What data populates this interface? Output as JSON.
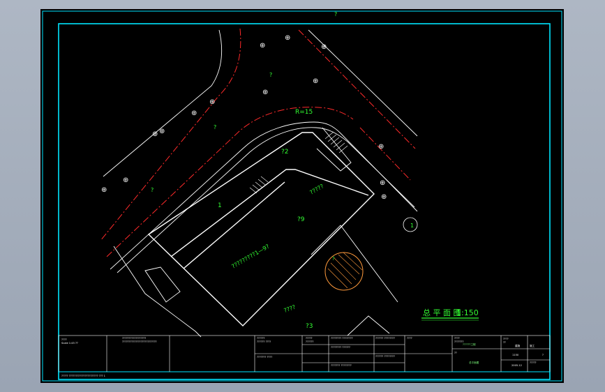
{
  "drawing": {
    "top_marker": "?",
    "radius_label": "R=15",
    "road_label_top": "?",
    "road_label_mid": "?",
    "road_label_left": "?",
    "area_label_1": "1",
    "area_label_2": "?2",
    "area_label_3": "?3",
    "area_label_29": "?9",
    "building_label": "?????????1—9?",
    "stair_label": "?????",
    "lower_label": "????",
    "right_circle_label": "1",
    "hatch_label": "?",
    "tree_symbol": "⊕",
    "plan_title": "总 平 面 图",
    "plan_scale": "1:150",
    "colors": {
      "frame": "#00e5ff",
      "building": "#ffffff",
      "road": "#ff2a2a",
      "text": "#33ff33",
      "hatch": "#ff9a3c",
      "title": "#33ff33"
    }
  },
  "title_block": {
    "cell_a1": "????",
    "cell_a2": "Scale 1:45 ??",
    "cell_b1": "??????????????????",
    "cell_b2": "??????????????????????????",
    "cell_c1": "??????",
    "cell_c2": "?????? ????",
    "cell_c3": "??????? ????",
    "cell_d1": "?????",
    "cell_d2": "??????",
    "cell_e1": "???????? ????????",
    "cell_e2": "???????? ??????",
    "cell_e3": "??????? ????????",
    "cell_f1": "?????? ????????",
    "cell_f2": "?????? ????????",
    "cell_g1": "????",
    "cell_h1": "????",
    "cell_h2": "???????",
    "cell_i1": "?",
    "cell_project": "??????工程",
    "cell_drawing": "??",
    "cell_drawing_name": "总平面图",
    "cell_j1": "????",
    "cell_j2": "??",
    "cell_k1": "建施",
    "cell_k2": "1150",
    "cell_k3": "2005.12",
    "cell_l1": "施工",
    "cell_l2": "?????",
    "cell_m1": "?",
    "footer_note": "????? ?????????????????????? ??? 1"
  }
}
